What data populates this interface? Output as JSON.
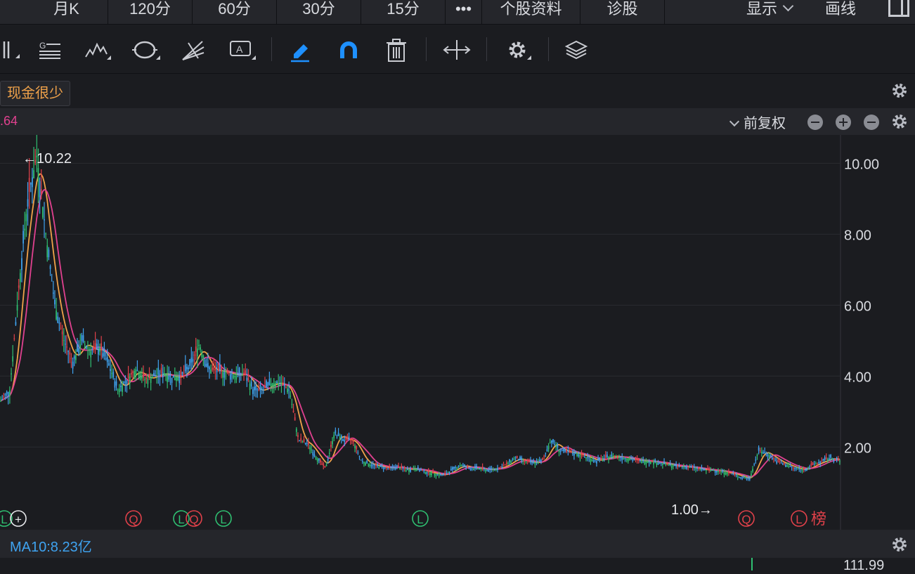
{
  "tabs": {
    "items": [
      {
        "label": "月K"
      },
      {
        "label": "120分"
      },
      {
        "label": "60分"
      },
      {
        "label": "30分"
      },
      {
        "label": "15分"
      },
      {
        "label": "•••"
      },
      {
        "label": "个股资料"
      },
      {
        "label": "诊股"
      }
    ],
    "display_label": "显示",
    "draw_label": "画线"
  },
  "toolbar": {
    "icons": [
      "bar-style-icon",
      "text-lines-icon",
      "zigzag-icon",
      "cycle-icon",
      "fan-icon",
      "annotation-icon",
      "pen-icon",
      "magnet-icon",
      "trash-icon",
      "expand-icon",
      "settings-icon",
      "layers-icon"
    ],
    "active_color": "#1e90ff"
  },
  "tagbar": {
    "tag_label": "现金很少"
  },
  "infobar": {
    "ma_value": ".64",
    "adjust_label": "前复权"
  },
  "chart_data": {
    "type": "candlestick",
    "y_axis_ticks": [
      "10.00",
      "8.00",
      "6.00",
      "4.00",
      "2.00"
    ],
    "ylim": [
      0.5,
      10.8
    ],
    "price_points": [
      3.3,
      3.6,
      6.5,
      9.0,
      10.22,
      8.0,
      6.0,
      5.0,
      4.4,
      5.0,
      4.7,
      4.8,
      4.3,
      3.6,
      3.9,
      4.2,
      3.9,
      4.0,
      4.1,
      3.95,
      4.0,
      4.3,
      4.9,
      4.2,
      4.15,
      4.1,
      4.0,
      4.1,
      3.6,
      3.6,
      3.8,
      3.8,
      3.6,
      2.2,
      2.1,
      1.7,
      1.4,
      2.4,
      2.2,
      2.2,
      1.6,
      1.5,
      1.45,
      1.4,
      1.45,
      1.35,
      1.4,
      1.3,
      1.25,
      1.2,
      1.35,
      1.5,
      1.4,
      1.4,
      1.35,
      1.4,
      1.5,
      1.7,
      1.6,
      1.55,
      1.6,
      2.2,
      1.9,
      1.85,
      1.8,
      1.7,
      1.6,
      1.7,
      1.75,
      1.7,
      1.65,
      1.6,
      1.6,
      1.55,
      1.5,
      1.45,
      1.45,
      1.4,
      1.35,
      1.35,
      1.3,
      1.25,
      1.15,
      1.1,
      1.9,
      1.8,
      1.6,
      1.5,
      1.4,
      1.35,
      1.5,
      1.6,
      1.7,
      1.6
    ],
    "high_label": "←10.22",
    "low_label": "1.00→",
    "markers": [
      {
        "text": "L",
        "kind": "L"
      },
      {
        "text": "+",
        "kind": "plus"
      },
      {
        "text": "Q",
        "kind": "Q"
      },
      {
        "text": "L",
        "kind": "L"
      },
      {
        "text": "Q",
        "kind": "Q"
      },
      {
        "text": "L",
        "kind": "L"
      },
      {
        "text": "L",
        "kind": "L"
      },
      {
        "text": "Q",
        "kind": "Q"
      },
      {
        "text": "L",
        "kind": "Q"
      },
      {
        "text": "榜",
        "kind": "bang"
      }
    ],
    "colors": {
      "up": "#2fbf71",
      "down": "#e0414a",
      "ma_orange": "#f0a24a",
      "ma_pink": "#e0418f",
      "ma_blue": "#3fa3f0",
      "grid": "#2a2b30"
    }
  },
  "volume": {
    "ma_label": "MA10:8.23亿",
    "axis_label": "111.99"
  }
}
